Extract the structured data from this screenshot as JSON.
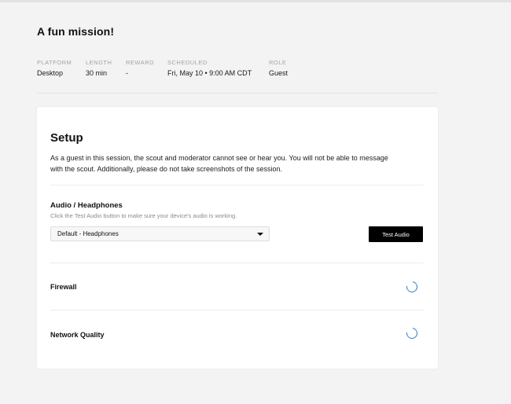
{
  "mission": {
    "title": "A fun mission!"
  },
  "meta": {
    "platform": {
      "label": "PLATFORM",
      "value": "Desktop"
    },
    "length": {
      "label": "LENGTH",
      "value": "30 min"
    },
    "reward": {
      "label": "REWARD",
      "value": "-"
    },
    "scheduled": {
      "label": "SCHEDULED",
      "value": "Fri, May 10 • 9:00 AM CDT"
    },
    "role": {
      "label": "ROLE",
      "value": "Guest"
    }
  },
  "setup": {
    "title": "Setup",
    "description": "As a guest in this session, the scout and moderator cannot see or hear you. You will not be able to message with the scout. Additionally, please do not take screenshots of the session.",
    "audio": {
      "title": "Audio / Headphones",
      "hint": "Click the Test Audio button to make sure your device's audio is working.",
      "selected_device": "Default - Headphones",
      "test_button_label": "Test Audio"
    },
    "checks": {
      "firewall": {
        "label": "Firewall",
        "status_icon": "loading-spinner-icon"
      },
      "network": {
        "label": "Network Quality",
        "status_icon": "loading-spinner-icon"
      }
    }
  },
  "colors": {
    "accent_spinner": "#2e7fd1",
    "button_bg": "#000000",
    "page_bg": "#f3f3f3"
  }
}
